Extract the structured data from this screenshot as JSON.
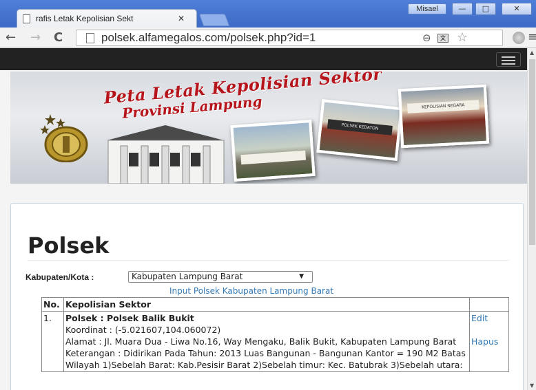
{
  "browser": {
    "tab_title": "rafis Letak Kepolisian Sekt",
    "tab_close": "✕",
    "user_badge": "Misael",
    "url": "polsek.alfamegalos.com/polsek.php?id=1"
  },
  "banner": {
    "title_line1": "Peta Letak Kepolisian Sektor",
    "title_line2": "Provinsi   Lampung",
    "photo_signs": [
      "",
      "POLSEK KEDATON",
      "KEPOLISIAN NEGARA"
    ]
  },
  "page": {
    "title": "Polsek",
    "filter_label": "Kabupaten/Kota :",
    "filter_selected": "Kabupaten Lampung Barat",
    "input_link": "Input Polsek Kabupaten Lampung Barat"
  },
  "table": {
    "headers": [
      "No.",
      "Kepolisian Sektor",
      ""
    ],
    "rows": [
      {
        "no": "1.",
        "name": "Polsek : Polsek Balik Bukit",
        "koordinat": "Koordinat : (-5.021607,104.060072)",
        "alamat": "Alamat : Jl. Muara Dua - Liwa No.16, Way Mengaku, Balik Bukit, Kabupaten Lampung Barat",
        "keterangan": "Keterangan : Didirikan Pada Tahun: 2013 Luas Bangunan - Bangunan Kantor = 190 M2 Batas Wilayah 1)Sebelah Barat: Kab.Pesisir Barat 2)Sebelah timur: Kec. Batubrak 3)Sebelah utara:",
        "edit": "Edit",
        "hapus": "Hapus"
      }
    ]
  }
}
